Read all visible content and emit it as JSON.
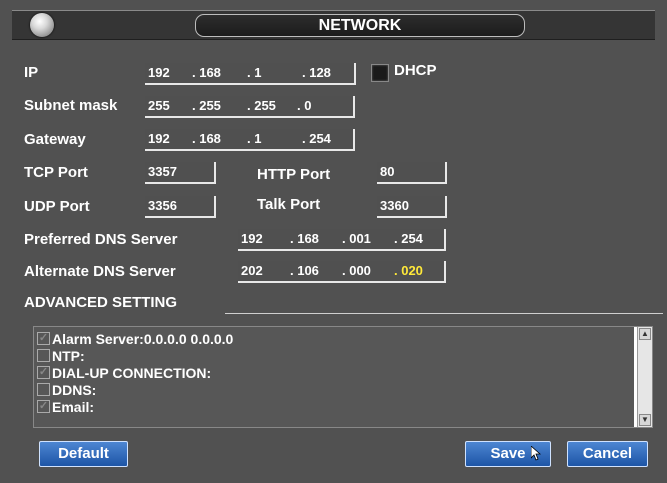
{
  "title": "NETWORK",
  "labels": {
    "ip": "IP",
    "subnet": "Subnet mask",
    "gateway": "Gateway",
    "tcp": "TCP Port",
    "http": "HTTP Port",
    "udp": "UDP Port",
    "talk": "Talk Port",
    "pdns": "Preferred DNS Server",
    "adns": "Alternate DNS Server",
    "dhcp": "DHCP",
    "advanced": "ADVANCED SETTING"
  },
  "ip": [
    "192",
    ". 168",
    ". 1",
    ". 128"
  ],
  "subnet": [
    "255",
    ". 255",
    ". 255",
    ". 0"
  ],
  "gateway": [
    "192",
    ". 168",
    ". 1",
    ". 254"
  ],
  "tcp_port": "3357",
  "http_port": "80",
  "udp_port": "3356",
  "talk_port": "3360",
  "pdns": [
    "192",
    ". 168",
    ". 001",
    ". 254"
  ],
  "adns": [
    "202",
    ". 106",
    ". 000",
    ". 020"
  ],
  "advanced_items": [
    {
      "label": "Alarm Server:0.0.0.0 0.0.0.0",
      "checked": true
    },
    {
      "label": "NTP:",
      "checked": false
    },
    {
      "label": "DIAL-UP CONNECTION:",
      "checked": true
    },
    {
      "label": "DDNS:",
      "checked": false
    },
    {
      "label": "Email:",
      "checked": true
    }
  ],
  "buttons": {
    "default": "Default",
    "save": "Save",
    "cancel": "Cancel"
  }
}
